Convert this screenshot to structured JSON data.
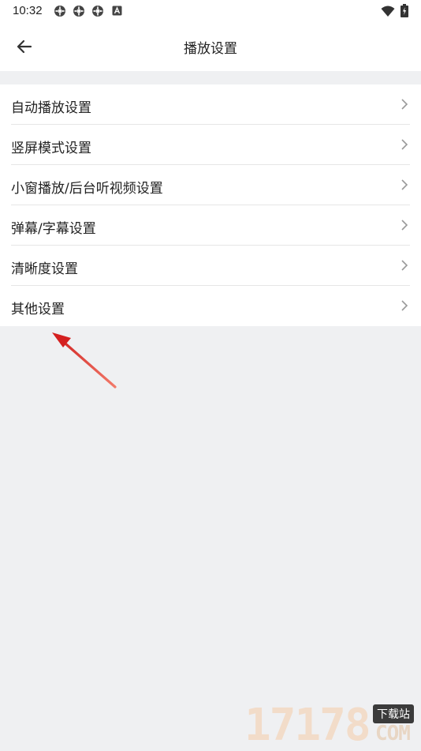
{
  "status_bar": {
    "time": "10:32",
    "left_icons": [
      "settings-icon",
      "settings-icon",
      "settings-icon",
      "a-icon"
    ],
    "right_icons": [
      "wifi-icon",
      "battery-icon"
    ]
  },
  "header": {
    "title": "播放设置",
    "back_icon": "arrow-left-icon"
  },
  "settings": {
    "items": [
      {
        "label": "自动播放设置"
      },
      {
        "label": "竖屏模式设置"
      },
      {
        "label": "小窗播放/后台听视频设置"
      },
      {
        "label": "弹幕/字幕设置"
      },
      {
        "label": "清晰度设置"
      },
      {
        "label": "其他设置"
      }
    ]
  },
  "watermark": {
    "digits": "17178",
    "tag": "下载站",
    "suffix": "COM"
  },
  "colors": {
    "background": "#eff0f2",
    "surface": "#ffffff",
    "text": "#222222",
    "annotation_arrow": "#d42020"
  }
}
